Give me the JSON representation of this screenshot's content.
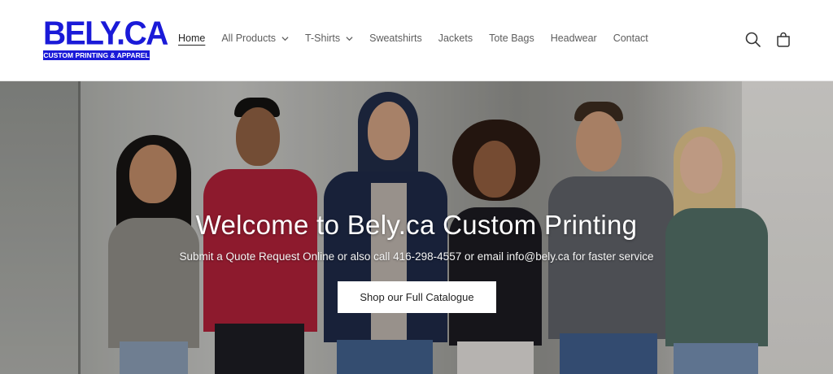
{
  "logo": {
    "main": "BELY.CA",
    "sub": "CUSTOM PRINTING & APPAREL"
  },
  "nav": {
    "items": [
      {
        "label": "Home",
        "active": true
      },
      {
        "label": "All Products",
        "dropdown": true
      },
      {
        "label": "T-Shirts",
        "dropdown": true
      },
      {
        "label": "Sweatshirts"
      },
      {
        "label": "Jackets"
      },
      {
        "label": "Tote Bags"
      },
      {
        "label": "Headwear"
      },
      {
        "label": "Contact"
      }
    ]
  },
  "header_icons": [
    "search-icon",
    "cart-icon"
  ],
  "hero": {
    "title": "Welcome to Bely.ca Custom Printing",
    "subtitle": "Submit a Quote Request Online or also call 416-298-4557 or email info@bely.ca for faster service",
    "button_label": "Shop our Full Catalogue"
  },
  "colors": {
    "brand_blue": "#1a1ad8",
    "nav_text": "#5d5d5d",
    "button_bg": "#ffffff"
  }
}
